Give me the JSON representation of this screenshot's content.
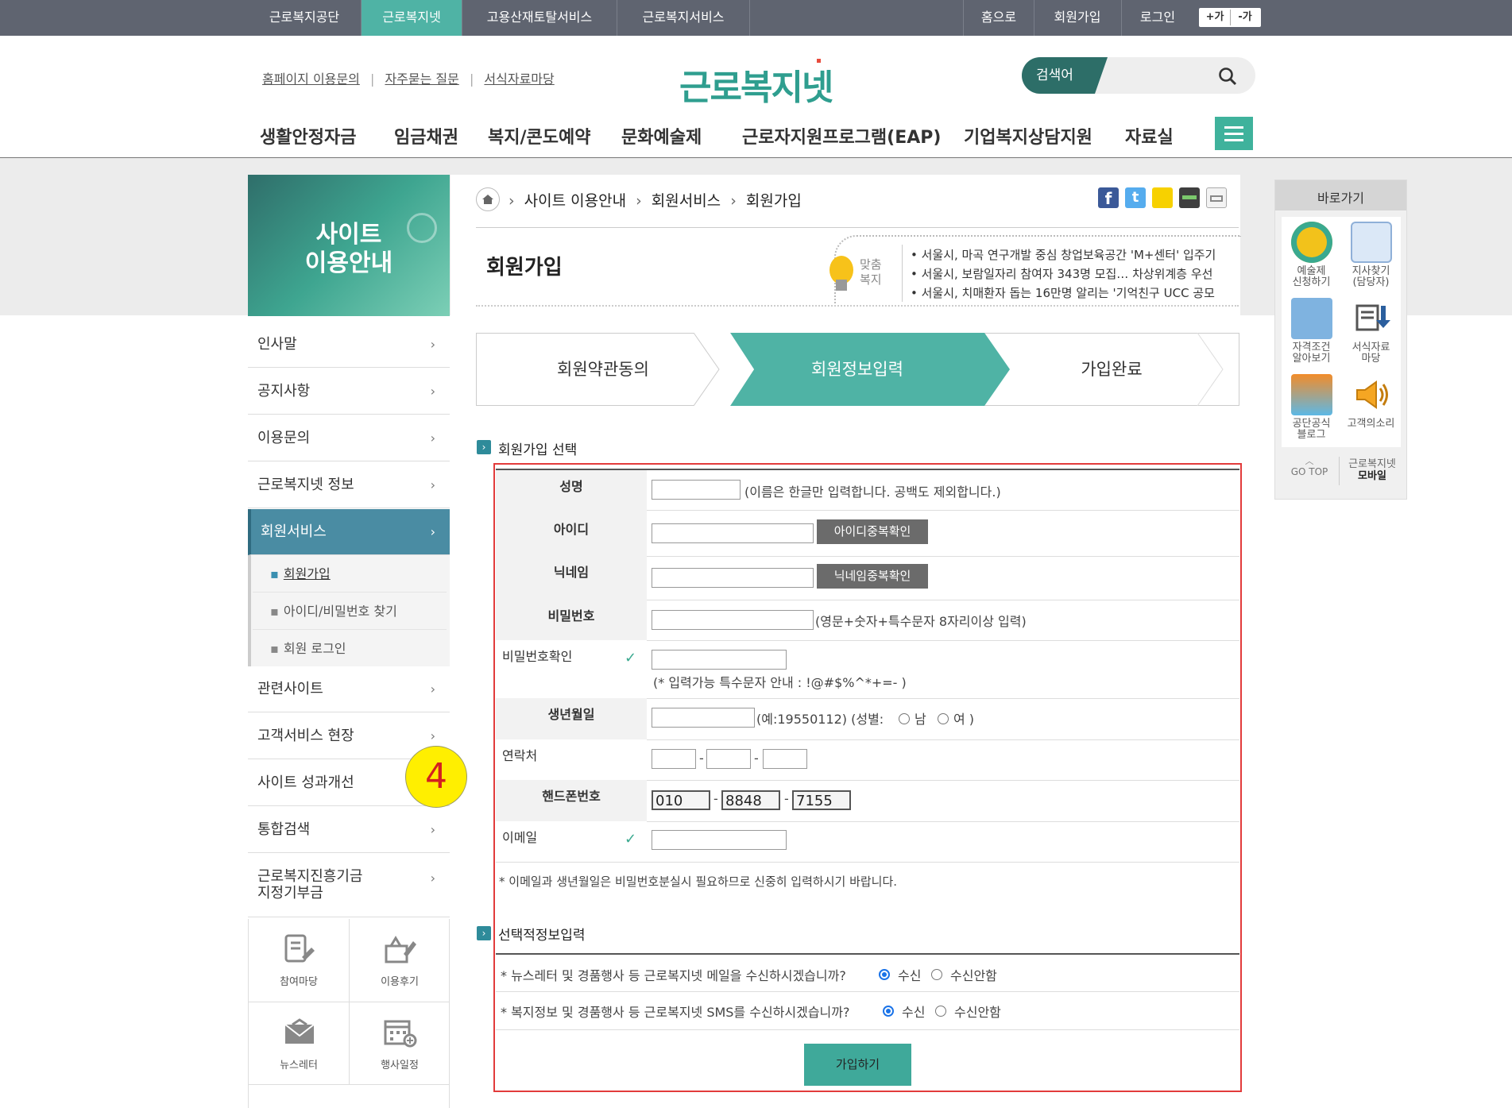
{
  "topbar": {
    "sites": [
      "근로복지공단",
      "근로복지넷",
      "고용산재토탈서비스",
      "근로복지서비스"
    ],
    "right": [
      "홈으로",
      "회원가입",
      "로그인"
    ],
    "font_plus": "+가",
    "font_minus": "-가"
  },
  "util_links": [
    "홈페이지 이용문의",
    "자주묻는 질문",
    "서식자료마당"
  ],
  "logo": "근로복지넷",
  "search": {
    "label": "검색어"
  },
  "gnb": [
    "생활안정자금",
    "임금채권",
    "복지/콘도예약",
    "문화예술제",
    "근로자지원프로그램(EAP)",
    "기업복지상담지원",
    "자료실"
  ],
  "sidebar": {
    "title_line1": "사이트",
    "title_line2": "이용안내",
    "items": [
      "인사말",
      "공지사항",
      "이용문의",
      "근로복지넷 정보",
      "회원서비스"
    ],
    "sub_items": [
      "회원가입",
      "아이디/비밀번호 찾기",
      "회원 로그인"
    ],
    "items_after": [
      "관련사이트",
      "고객서비스 현장",
      "사이트 성과개선",
      "통합검색"
    ],
    "fund_line1": "근로복지진흥기금",
    "fund_line2": "지정기부금",
    "icons": [
      "참여마당",
      "이용후기",
      "뉴스레터",
      "행사일정"
    ]
  },
  "badge": "4",
  "breadcrumb": [
    "사이트 이용안내",
    "회원서비스",
    "회원가입"
  ],
  "page_title": "회원가입",
  "custom_welfare": {
    "label_line1": "맞춤",
    "label_line2": "복지",
    "news": [
      "서울시, 마곡 연구개발 중심 창업보육공간 'M+센터' 입주기",
      "서울시, 보람일자리 참여자 343명 모집… 차상위계층 우선",
      "서울시, 치매환자 돕는 16만명 알리는 '기억친구 UCC 공모"
    ]
  },
  "steps": [
    "회원약관동의",
    "회원정보입력",
    "가입완료"
  ],
  "section1_title": "회원가입 선택",
  "form": {
    "name_label": "성명",
    "name_hint": "(이름은 한글만 입력합니다. 공백도 제외합니다.)",
    "id_label": "아이디",
    "id_button": "아이디중복확인",
    "nick_label": "닉네임",
    "nick_button": "닉네임중복확인",
    "pw_label": "비밀번호",
    "pw_hint": "(영문+숫자+특수문자 8자리이상 입력)",
    "pw_confirm_label": "비밀번호확인",
    "pw_confirm_hint": "(* 입력가능 특수문자 안내 : !@#$%^*+=- )",
    "birth_label": "생년월일",
    "birth_hint": "(예:19550112) (성별:",
    "gender_male": "남",
    "gender_female": "여 )",
    "phone_label": "연락처",
    "mobile_label": "핸드폰번호",
    "mobile": [
      "010",
      "8848",
      "7155"
    ],
    "email_label": "이메일",
    "note": "* 이메일과 생년월일은 비밀번호분실시 필요하므로 신중히 입력하시기 바랍니다."
  },
  "section2_title": "선택적정보입력",
  "optional": {
    "q1": "* 뉴스레터 및 경품행사 등 근로복지넷 메일을 수신하시겠습니까?",
    "q2": "* 복지정보 및 경품행사 등 근로복지넷 SMS를 수신하시겠습니까?",
    "yes": "수신",
    "no": "수신안함"
  },
  "submit": "가입하기",
  "quick": {
    "title": "바로가기",
    "items": [
      {
        "l1": "예술제",
        "l2": "신청하기"
      },
      {
        "l1": "지사찾기",
        "l2": "(담당자)"
      },
      {
        "l1": "자격조건",
        "l2": "알아보기"
      },
      {
        "l1": "서식자료",
        "l2": "마당"
      },
      {
        "l1": "공단공식",
        "l2": "블로그"
      },
      {
        "l1": "고객의소리",
        "l2": ""
      }
    ],
    "gotop": "GO TOP",
    "mobile_l1": "근로복지넷",
    "mobile_l2": "모바일"
  },
  "colors": {
    "accent": "#4fb3a5",
    "topbar": "#5f6470",
    "highlight": "#e23b3b",
    "badge": "#ffef00"
  }
}
